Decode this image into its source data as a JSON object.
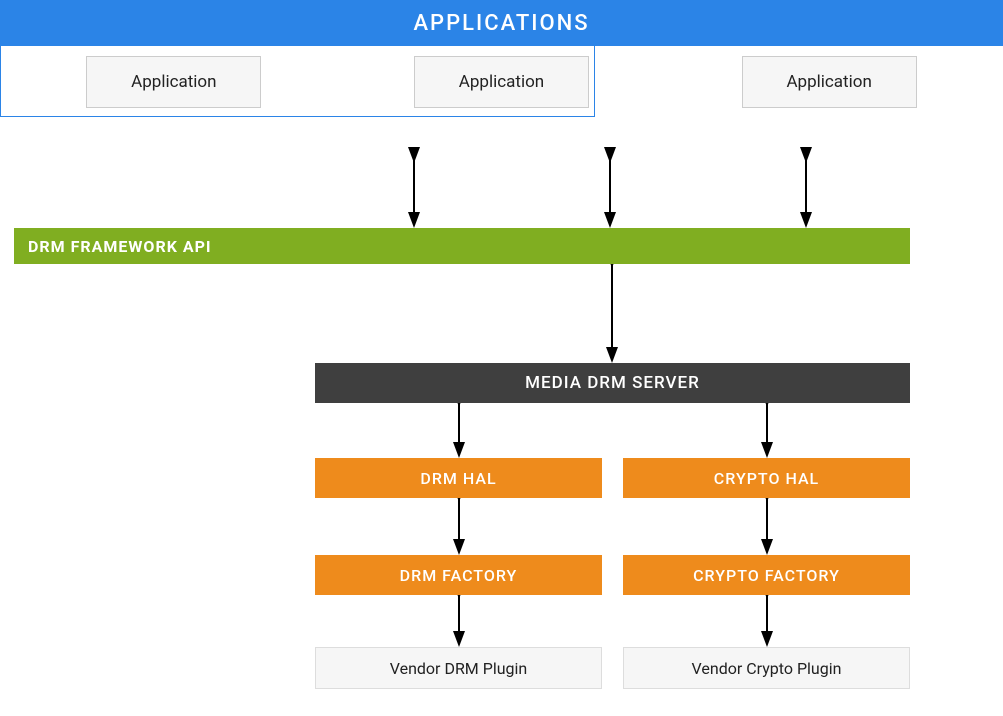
{
  "applications": {
    "header": "APPLICATIONS",
    "items": [
      "Application",
      "Application",
      "Application"
    ]
  },
  "framework": {
    "label": "DRM FRAMEWORK API"
  },
  "media_server": {
    "label": "MEDIA DRM SERVER"
  },
  "hal": {
    "drm": "DRM HAL",
    "crypto": "CRYPTO HAL"
  },
  "factory": {
    "drm": "DRM FACTORY",
    "crypto": "CRYPTO FACTORY"
  },
  "vendor": {
    "drm": "Vendor DRM Plugin",
    "crypto": "Vendor Crypto Plugin"
  }
}
